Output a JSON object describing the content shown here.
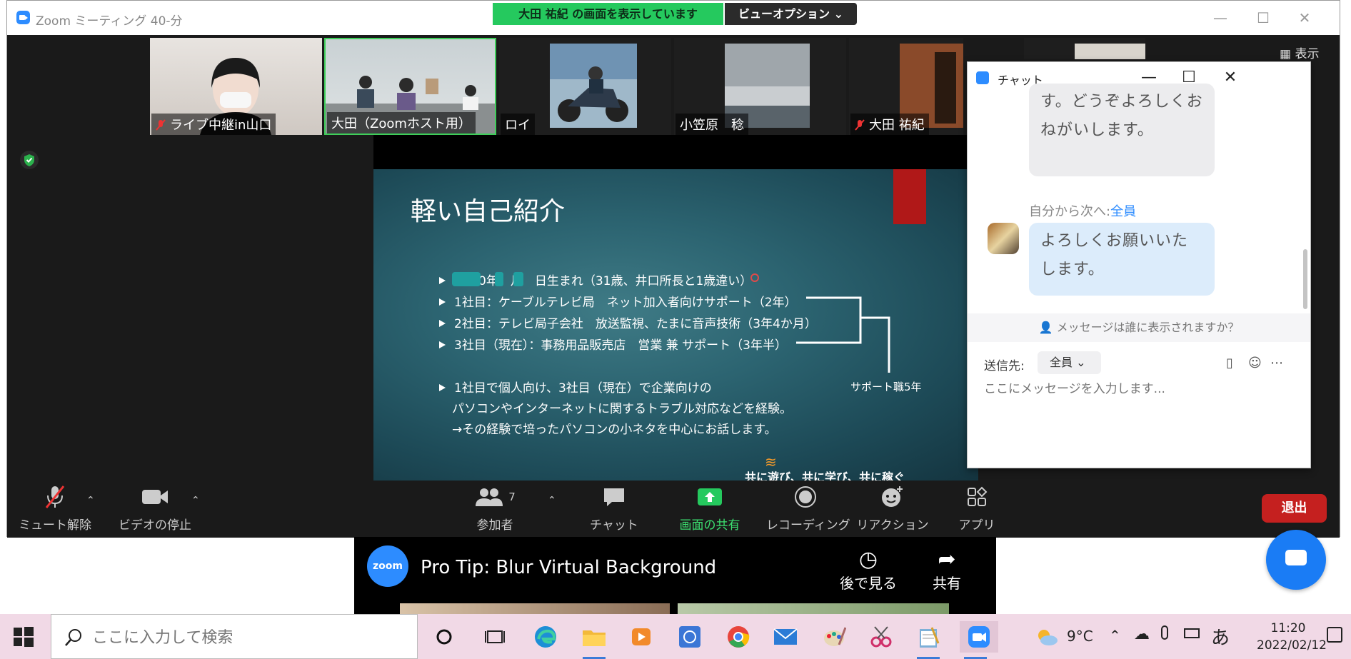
{
  "window": {
    "title": "Zoom ミーティング 40-分",
    "sharing_banner": "大田 祐紀 の画面を表示しています",
    "view_options": "ビューオプション ⌄",
    "view_button": "表示"
  },
  "participants": [
    {
      "name": "ライブ中継in山口",
      "muted": true
    },
    {
      "name": "大田（Zoomホスト用）",
      "muted": false
    },
    {
      "name": "ロイ",
      "muted": false
    },
    {
      "name": "小笠原　稔",
      "muted": false
    },
    {
      "name": "大田 祐紀",
      "muted": true
    }
  ],
  "slide": {
    "title": "軽い自己紹介",
    "bullets": [
      "　　0年　月　日生まれ（31歳、井口所長と1歳違い）",
      "1社目：ケーブルテレビ局　ネット加入者向けサポート（2年）",
      "2社目：テレビ局子会社　放送監視、たまに音声技術（3年4か月）",
      "3社目（現在）：事務用品販売店　営業 兼 サポート（3年半）"
    ],
    "bracket_label": "サポート職5年",
    "summary": [
      "1社目で個人向け、3社目（現在）で企業向けの",
      "パソコンやインターネットに関するトラブル対応などを経験。",
      "→その経験で培ったパソコンの小ネタを中心にお話します。"
    ],
    "footer_text": "共に遊び、共に学び、共に稼ぐ"
  },
  "toolbar": {
    "mute": "ミュート解除",
    "video": "ビデオの停止",
    "participants": "参加者",
    "participants_count": "7",
    "chat": "チャット",
    "share": "画面の共有",
    "record": "レコーディング",
    "reactions": "リアクション",
    "apps": "アプリ",
    "leave": "退出"
  },
  "chat": {
    "title": "チャット",
    "message1": "す。どうぞよろしくおねがいします。",
    "sender_prefix": "自分から次へ:",
    "sender_to": "全員",
    "message2": "よろしくお願いいたします。",
    "visibility": "メッセージは誰に表示されますか？",
    "send_to_label": "送信先:",
    "send_to_value": "全員",
    "input_placeholder": "ここにメッセージを入力します..."
  },
  "video_strip": {
    "logo": "zoom",
    "title": "Pro Tip: Blur Virtual Background",
    "watch_later": "後で見る",
    "share": "共有"
  },
  "taskbar": {
    "search_placeholder": "ここに入力して検索",
    "temperature": "9°C",
    "ime": "あ",
    "time": "11:20",
    "date": "2022/02/12"
  },
  "colors": {
    "zoom_blue": "#2d8cff",
    "share_green": "#25c95e",
    "leave_red": "#c5201f",
    "taskbar": "#f1d9e6"
  }
}
